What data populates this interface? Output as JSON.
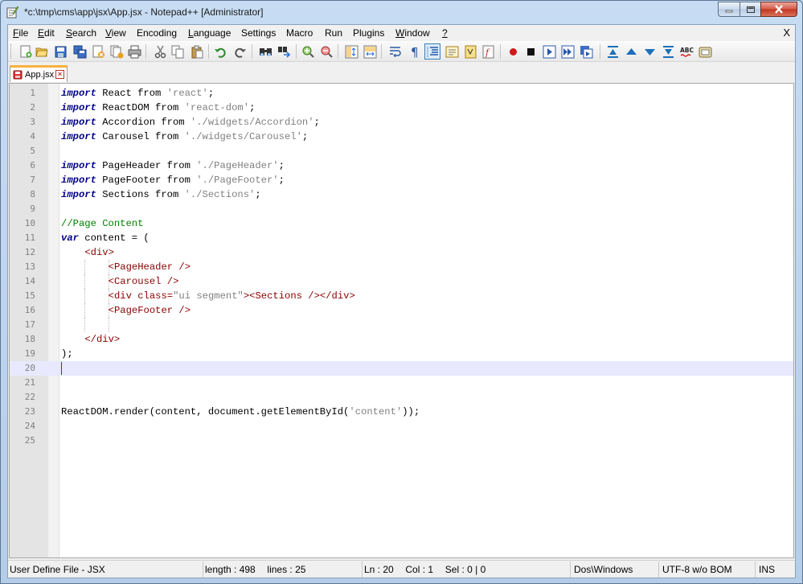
{
  "window": {
    "title": "*c:\\tmp\\cms\\app\\jsx\\App.jsx - Notepad++ [Administrator]"
  },
  "menu": {
    "items": [
      {
        "key": "F",
        "rest": "ile"
      },
      {
        "key": "E",
        "rest": "dit"
      },
      {
        "key": "S",
        "rest": "earch"
      },
      {
        "key": "V",
        "rest": "iew",
        "pre": ""
      },
      {
        "key": "",
        "rest": "Encoding"
      },
      {
        "key": "L",
        "rest": "anguage"
      },
      {
        "key": "",
        "rest": "Settings"
      },
      {
        "key": "",
        "rest": "Macro"
      },
      {
        "key": "",
        "rest": "Run"
      },
      {
        "key": "",
        "rest": "Plugins"
      },
      {
        "key": "W",
        "rest": "indow"
      },
      {
        "key": "?",
        "rest": ""
      }
    ],
    "close": "X"
  },
  "toolbar": {
    "buttons": [
      "new-file",
      "open-file",
      "save",
      "save-all",
      "close",
      "close-all",
      "print",
      "cut",
      "copy",
      "paste",
      "undo",
      "redo",
      "find",
      "replace",
      "zoom-in",
      "zoom-out",
      "sync-vertical",
      "sync-horizontal",
      "word-wrap",
      "show-all-chars",
      "indent-guide",
      "define-language",
      "document-map",
      "function-list",
      "record-macro",
      "stop-recording",
      "playback-macro",
      "run-macro-multiple",
      "save-macro",
      "collapse-level",
      "move-up",
      "move-down",
      "expand-level",
      "spell-check",
      "clipboard-history"
    ]
  },
  "tabs": [
    {
      "label": "App.jsx"
    }
  ],
  "editor": {
    "current_line": 20,
    "lines": [
      {
        "n": "1",
        "tokens": [
          {
            "t": "import",
            "c": "kw"
          },
          {
            "t": " React from "
          },
          {
            "t": "'react'",
            "c": "str"
          },
          {
            "t": ";"
          }
        ]
      },
      {
        "n": "2",
        "tokens": [
          {
            "t": "import",
            "c": "kw"
          },
          {
            "t": " ReactDOM from "
          },
          {
            "t": "'react-dom'",
            "c": "str"
          },
          {
            "t": ";"
          }
        ]
      },
      {
        "n": "3",
        "tokens": [
          {
            "t": "import",
            "c": "kw"
          },
          {
            "t": " Accordion from "
          },
          {
            "t": "'./widgets/Accordion'",
            "c": "str"
          },
          {
            "t": ";"
          }
        ]
      },
      {
        "n": "4",
        "tokens": [
          {
            "t": "import",
            "c": "kw"
          },
          {
            "t": " Carousel from "
          },
          {
            "t": "'./widgets/Carousel'",
            "c": "str"
          },
          {
            "t": ";"
          }
        ]
      },
      {
        "n": "5",
        "tokens": []
      },
      {
        "n": "6",
        "tokens": [
          {
            "t": "import",
            "c": "kw"
          },
          {
            "t": " PageHeader from "
          },
          {
            "t": "'./PageHeader'",
            "c": "str"
          },
          {
            "t": ";"
          }
        ]
      },
      {
        "n": "7",
        "tokens": [
          {
            "t": "import",
            "c": "kw"
          },
          {
            "t": " PageFooter from "
          },
          {
            "t": "'./PageFooter'",
            "c": "str"
          },
          {
            "t": ";"
          }
        ]
      },
      {
        "n": "8",
        "tokens": [
          {
            "t": "import",
            "c": "kw"
          },
          {
            "t": " Sections from "
          },
          {
            "t": "'./Sections'",
            "c": "str"
          },
          {
            "t": ";"
          }
        ]
      },
      {
        "n": "9",
        "tokens": []
      },
      {
        "n": "10",
        "tokens": [
          {
            "t": "//Page Content",
            "c": "cm"
          }
        ]
      },
      {
        "n": "11",
        "tokens": [
          {
            "t": "var",
            "c": "kw"
          },
          {
            "t": " content = ("
          }
        ]
      },
      {
        "n": "12",
        "indent": 1,
        "tokens": [
          {
            "t": "<div>",
            "c": "tag"
          }
        ]
      },
      {
        "n": "13",
        "indent": 2,
        "tokens": [
          {
            "t": "<PageHeader />",
            "c": "tag"
          }
        ]
      },
      {
        "n": "14",
        "indent": 2,
        "tokens": [
          {
            "t": "<Carousel />",
            "c": "tag"
          }
        ]
      },
      {
        "n": "15",
        "indent": 2,
        "tokens": [
          {
            "t": "<div class=",
            "c": "tag"
          },
          {
            "t": "\"ui segment\"",
            "c": "attrv"
          },
          {
            "t": "><Sections /></div>",
            "c": "tag"
          }
        ]
      },
      {
        "n": "16",
        "indent": 2,
        "tokens": [
          {
            "t": "<PageFooter />",
            "c": "tag"
          }
        ]
      },
      {
        "n": "17",
        "indent": 2,
        "tokens": []
      },
      {
        "n": "18",
        "indent": 1,
        "tokens": [
          {
            "t": "</div>",
            "c": "tag"
          }
        ]
      },
      {
        "n": "19",
        "tokens": [
          {
            "t": ");"
          }
        ]
      },
      {
        "n": "20",
        "tokens": []
      },
      {
        "n": "21",
        "tokens": []
      },
      {
        "n": "22",
        "tokens": []
      },
      {
        "n": "23",
        "tokens": [
          {
            "t": "ReactDOM.render(content, document.getElementById("
          },
          {
            "t": "'content'",
            "c": "str"
          },
          {
            "t": "));"
          }
        ]
      },
      {
        "n": "24",
        "tokens": []
      },
      {
        "n": "25",
        "tokens": []
      }
    ]
  },
  "status": {
    "file_type": "User Define File - JSX",
    "length": "length : 498",
    "lines": "lines : 25",
    "ln": "Ln : 20",
    "col": "Col : 1",
    "sel": "Sel : 0 | 0",
    "eol": "Dos\\Windows",
    "encoding": "UTF-8 w/o BOM",
    "mode": "INS"
  }
}
